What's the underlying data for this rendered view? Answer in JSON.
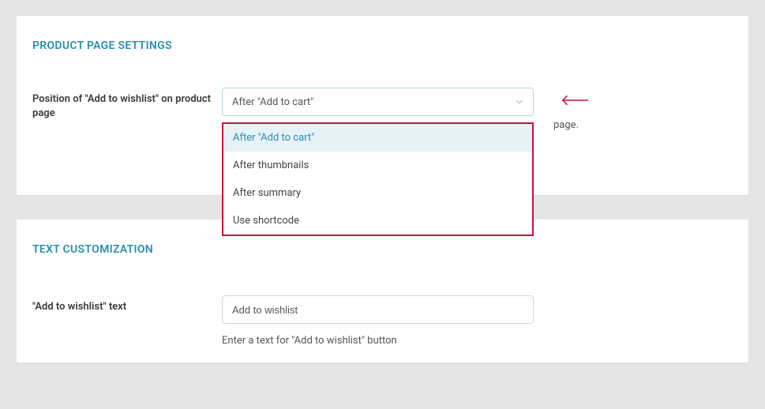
{
  "section1": {
    "title": "PRODUCT PAGE SETTINGS",
    "position_label": "Position of \"Add to wishlist\" on product page",
    "position_select": {
      "selected": "After \"Add to cart\"",
      "options": [
        "After \"Add to cart\"",
        "After thumbnails",
        "After summary",
        "Use shortcode"
      ]
    },
    "help_tail": "page."
  },
  "section2": {
    "title": "TEXT CUSTOMIZATION",
    "text_label": "\"Add to wishlist\" text",
    "text_value": "Add to wishlist",
    "hint": "Enter a text for \"Add to wishlist\" button"
  }
}
